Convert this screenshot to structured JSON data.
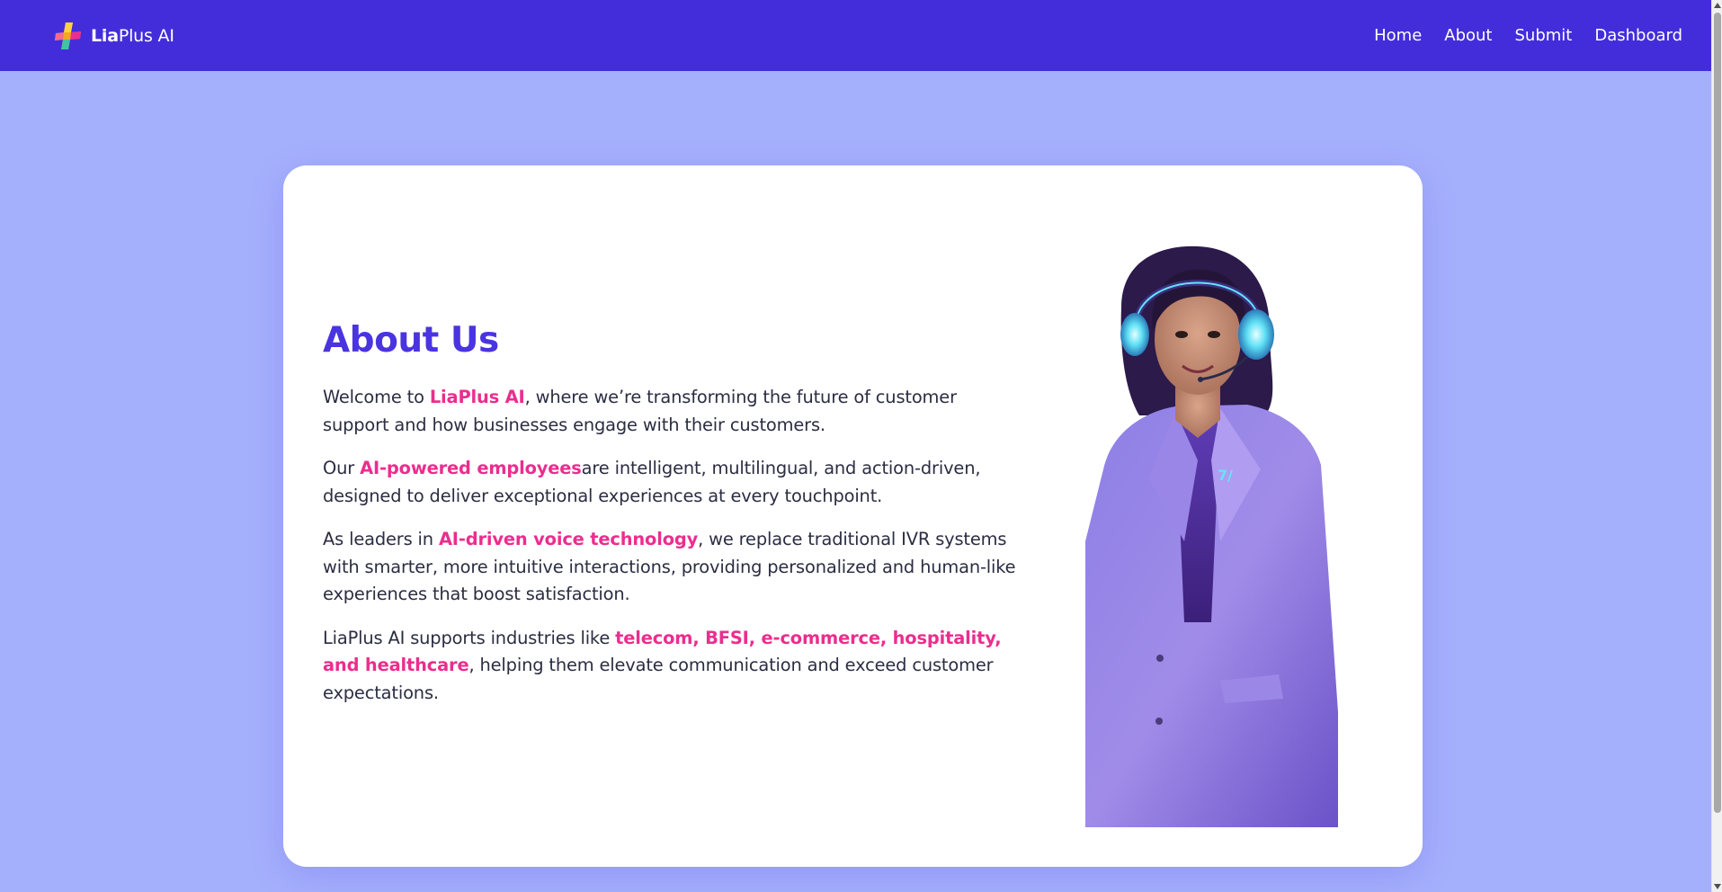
{
  "nav": {
    "brand_strong": "Lia",
    "brand_rest": "Plus AI",
    "links": [
      "Home",
      "About",
      "Submit",
      "Dashboard"
    ]
  },
  "about": {
    "heading": "About Us",
    "p1": {
      "before": "Welcome to ",
      "highlight": "LiaPlus AI",
      "after": ", where we’re transforming the future of customer support and how businesses engage with their customers."
    },
    "p2": {
      "before": "Our ",
      "highlight": "AI-powered employees",
      "after": "are intelligent, multilingual, and action-driven, designed to deliver exceptional experiences at every touchpoint."
    },
    "p3": {
      "before": "As leaders in ",
      "highlight": "AI-driven voice technology",
      "after": ", we replace traditional IVR systems with smarter, more intuitive interactions, providing personalized and human-like experiences that boost satisfaction."
    },
    "p4": {
      "before": "LiaPlus AI supports industries like ",
      "highlight": "telecom, BFSI, e-commerce, hospitality, and healthcare",
      "after": ", helping them elevate communication and exceed customer expectations."
    }
  },
  "colors": {
    "navbar": "#432ddb",
    "background": "#a5b0fc",
    "heading": "#4a34e0",
    "highlight": "#ec2d8e",
    "body_text": "#2b2d42"
  },
  "icons": {
    "logo": "liaplus-logo-icon",
    "illustration": "ai-agent-with-headset-illustration"
  }
}
